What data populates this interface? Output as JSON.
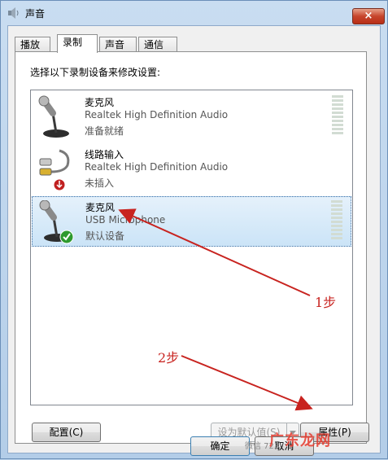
{
  "window": {
    "title": "声音",
    "close_label": "×"
  },
  "tabs": [
    {
      "label": "播放",
      "active": false
    },
    {
      "label": "录制",
      "active": true
    },
    {
      "label": "声音",
      "active": false
    },
    {
      "label": "通信",
      "active": false
    }
  ],
  "instruction": "选择以下录制设备来修改设置:",
  "devices": [
    {
      "name": "麦克风",
      "driver": "Realtek High Definition Audio",
      "status": "准备就绪",
      "icon": "microphone-icon",
      "selected": false
    },
    {
      "name": "线路输入",
      "driver": "Realtek High Definition Audio",
      "status": "未插入",
      "icon": "line-in-cable-icon",
      "selected": false
    },
    {
      "name": "麦克风",
      "driver": "USB Microphone",
      "status": "默认设备",
      "icon": "microphone-icon",
      "selected": true
    }
  ],
  "buttons": {
    "configure": "配置(C)",
    "set_default": "设为默认值(S)",
    "properties": "属性(P)",
    "ok": "确定",
    "cancel": "取消"
  },
  "annotations": {
    "step1": "1步",
    "step2": "2步"
  },
  "watermark": {
    "text": "广东龙网",
    "sub": "微信  723"
  },
  "colors": {
    "arrow": "#c8231f",
    "selection": "#cbe4f7",
    "close": "#c6452c"
  }
}
